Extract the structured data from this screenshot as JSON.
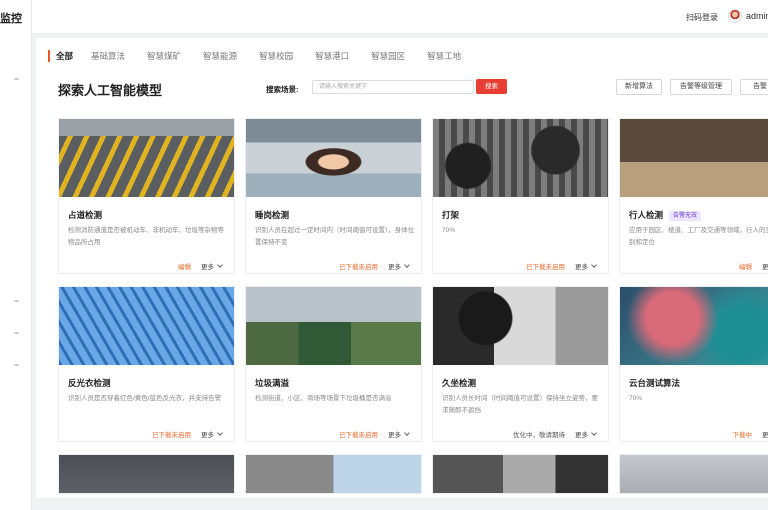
{
  "app": {
    "brand": "监控",
    "scan_login": "扫码登录",
    "username": "admin"
  },
  "tabs": [
    "全部",
    "基础算法",
    "智慧煤矿",
    "智慧能源",
    "智慧校园",
    "智慧港口",
    "智慧园区",
    "智慧工地"
  ],
  "page": {
    "title": "探索人工智能模型",
    "scene_label": "搜索场景:",
    "scene_placeholder": "请输入搜索关键字",
    "search_label": "搜索",
    "actions": [
      "新增算法",
      "告警等级管理",
      "告警"
    ]
  },
  "cards": [
    {
      "title": "占道检测",
      "badge": "",
      "desc": "检测消防通道是否被机动车、非机动车、垃圾等杂物等物品所占用",
      "status": "编辑",
      "more": "更多"
    },
    {
      "title": "睡岗检测",
      "badge": "",
      "desc": "识别人员在超过一定时间内（时间阈值可设置），身体位置保持不变",
      "status": "已下载未启用",
      "more": "更多"
    },
    {
      "title": "打架",
      "badge": "",
      "desc": "70%",
      "status": "已下载未启用",
      "more": "更多"
    },
    {
      "title": "行人检测",
      "badge": "告警无效",
      "desc": "应用于园区、楼道、工厂及交通等领域，行人的实时识别和定位",
      "status": "编辑",
      "more": "更多"
    },
    {
      "title": "反光衣检测",
      "badge": "",
      "desc": "识别人员是否穿着红色/黄色/蓝色反光衣，并支持告警",
      "status": "已下载未启用",
      "more": "更多"
    },
    {
      "title": "垃圾满溢",
      "badge": "",
      "desc": "检测街道、小区、商场等场景下垃圾桶是否满溢",
      "status": "已下载未启用",
      "more": "更多"
    },
    {
      "title": "久坐检测",
      "badge": "",
      "desc": "识别人员长时间（时间阈值可设置）保持坐立姿势，要求随即不遮挡",
      "status": "优化中，敬请期待",
      "more": "更多"
    },
    {
      "title": "云台测试算法",
      "badge": "",
      "desc": "70%",
      "status": "下载中",
      "more": "更多"
    }
  ],
  "icons": {
    "avatar": "user-avatar-icon",
    "more": "chevron-down-icon"
  },
  "colors": {
    "accent": "#e73e33",
    "status": "#ee6a2a",
    "badge": "#6b3fd9"
  }
}
